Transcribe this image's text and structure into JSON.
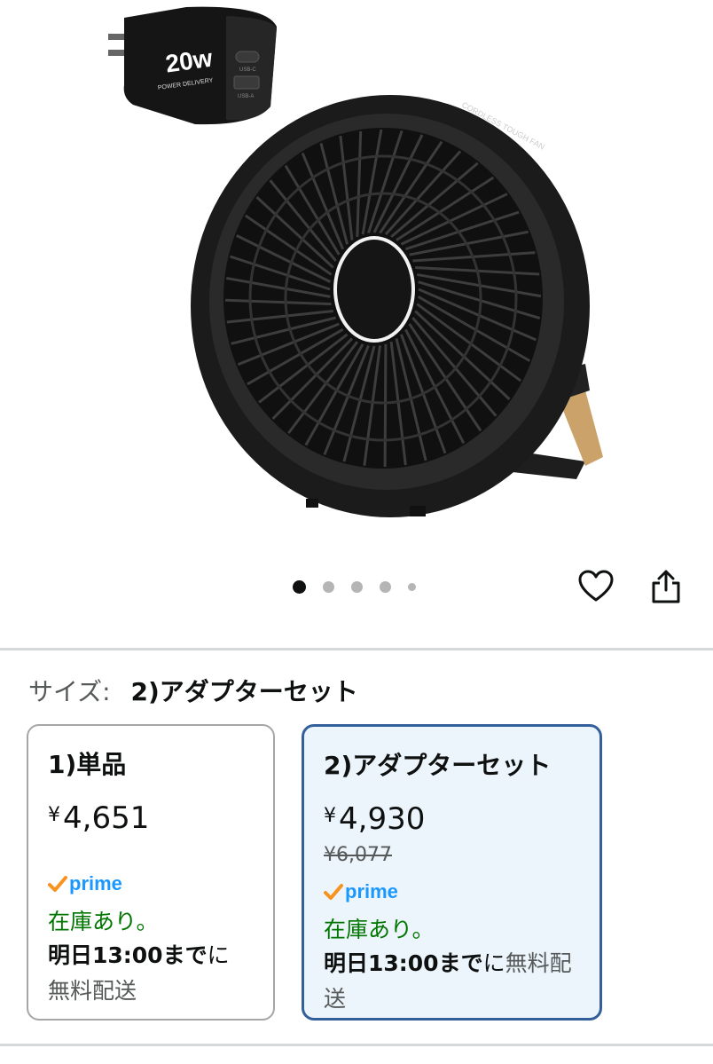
{
  "gallery": {
    "adapter_text": "20w",
    "adapter_subtext": "POWER DELIVERY",
    "port_labels": [
      "USB-C",
      "USB-A"
    ],
    "fan_brand_text": "CORDLESS TOUGH FAN",
    "dot_count": 5,
    "active_dot_index": 0
  },
  "size": {
    "label": "サイズ:",
    "selected": "2)アダプターセット"
  },
  "options": [
    {
      "title": "1)単品",
      "currency": "¥",
      "price": "4,651",
      "prime": "prime",
      "stock": "在庫あり。",
      "delivery_bold": "明日13:00まで",
      "delivery_rest": "に",
      "delivery_free": "無料配送"
    },
    {
      "title": "2)アダプターセット",
      "currency": "¥",
      "price": "4,930",
      "list_price": "¥6,077",
      "prime": "prime",
      "stock": "在庫あり。",
      "delivery_bold": "明日13:00まで",
      "delivery_rest": "に",
      "delivery_free": "無料配送"
    }
  ],
  "colors": {
    "prime_blue": "#1a98ff",
    "prime_check": "#f7931e",
    "in_stock_green": "#007600",
    "selected_border": "#33609a",
    "selected_bg": "#edf5fc"
  }
}
